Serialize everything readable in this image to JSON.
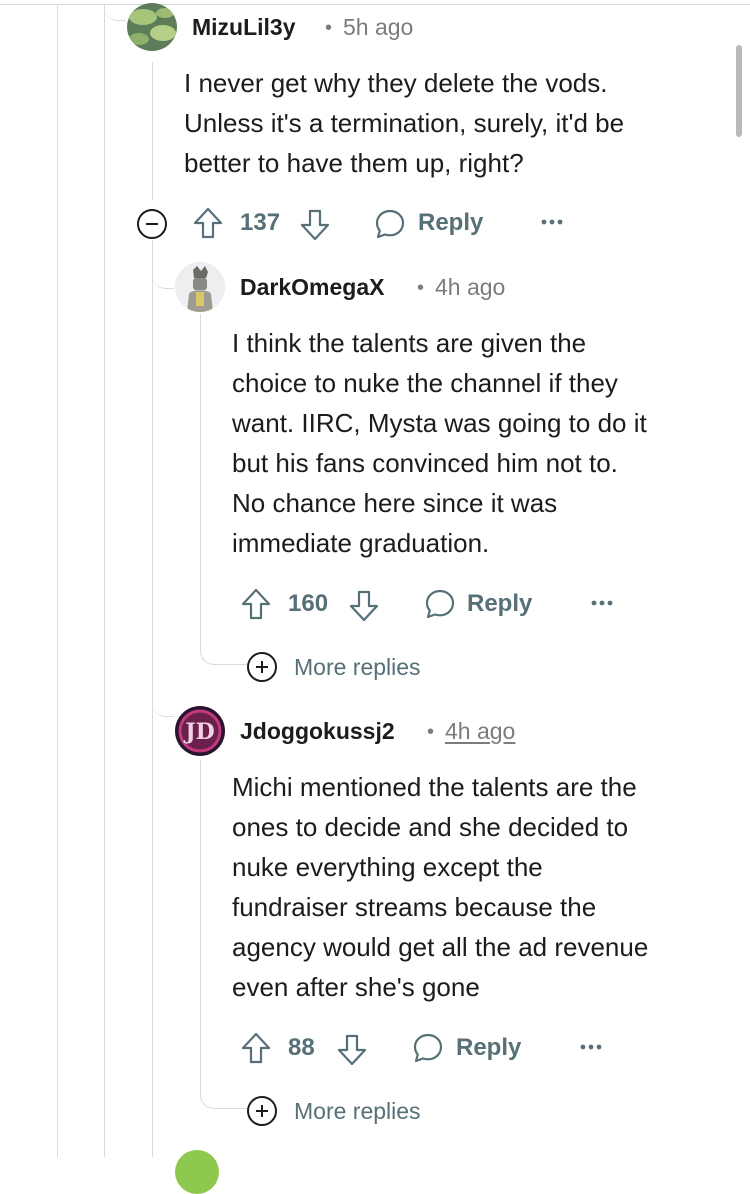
{
  "comments": [
    {
      "username": "MizuLil3y",
      "separator": "•",
      "time": "5h ago",
      "lines": [
        "I never get why they delete the vods.",
        "Unless it's a termination, surely, it'd be",
        "better to have them up, right?"
      ],
      "votes": "137",
      "reply_label": "Reply",
      "avatar_icon": "lily-pad-avatar"
    },
    {
      "username": "DarkOmegaX",
      "separator": "•",
      "time": "4h ago",
      "lines": [
        "I think the talents are given the",
        "choice to nuke the channel if they",
        "want. IIRC, Mysta was going to do it",
        "but his fans convinced him not to.",
        "No chance here since it was",
        "immediate graduation."
      ],
      "votes": "160",
      "reply_label": "Reply",
      "more_replies_label": "More replies",
      "avatar_icon": "knight-avatar"
    },
    {
      "username": "Jdoggokussj2",
      "separator": "•",
      "time": "4h ago",
      "lines": [
        "Michi mentioned the talents are the",
        "ones to decide and she decided to",
        "nuke everything except the",
        "fundraiser streams because the",
        "agency would get all the ad revenue",
        "even after she's gone"
      ],
      "votes": "88",
      "reply_label": "Reply",
      "more_replies_label": "More replies",
      "avatar_icon": "jd-logo-avatar"
    }
  ],
  "colors": {
    "meta_gray": "#576f76",
    "thread_line": "#d8dadc",
    "text": "#1c1c1c"
  }
}
